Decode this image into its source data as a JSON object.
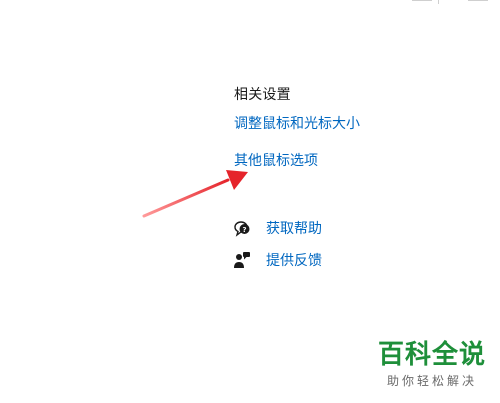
{
  "related_settings": {
    "title": "相关设置",
    "links": {
      "adjust_pointer_size": "调整鼠标和光标大小",
      "other_mouse_options": "其他鼠标选项"
    }
  },
  "help": {
    "get_help": {
      "label": "获取帮助",
      "icon": "help-chat-icon"
    },
    "feedback": {
      "label": "提供反馈",
      "icon": "feedback-person-icon"
    }
  },
  "annotation": {
    "arrow_color": "#e5242b"
  },
  "watermark": {
    "title": "百科全说",
    "subtitle": "助你轻松解决",
    "color": "#1e8f3a"
  },
  "colors": {
    "link": "#0067c0",
    "text": "#1a1a1a",
    "background": "#ffffff"
  }
}
